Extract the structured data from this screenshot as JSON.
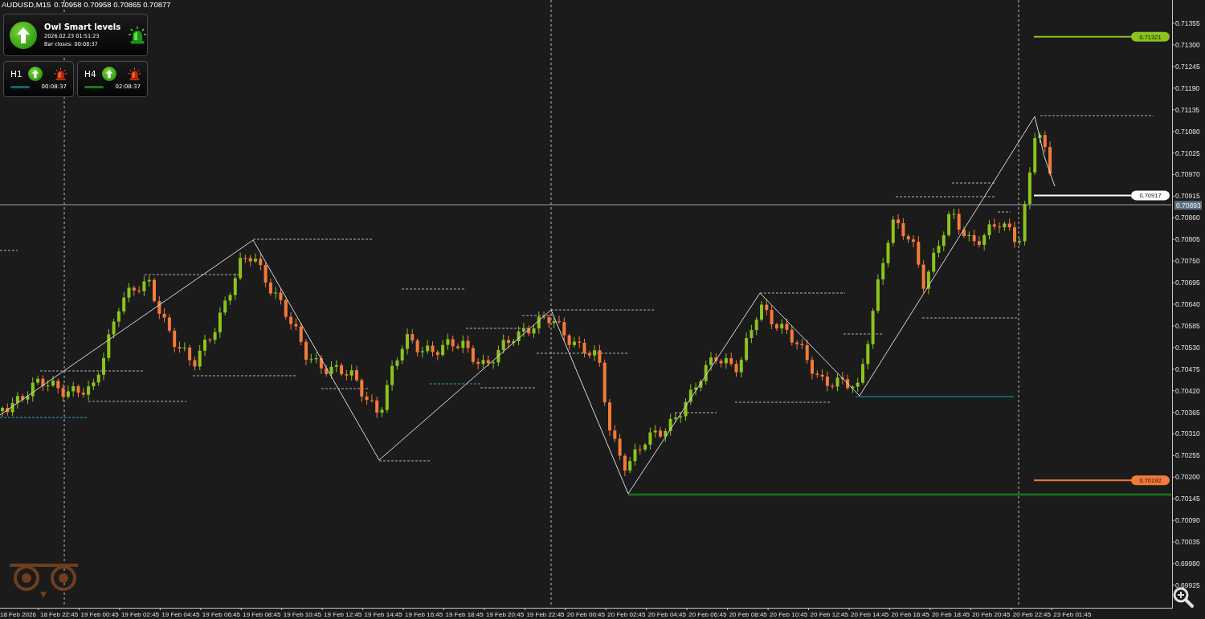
{
  "header": {
    "symbol": "AUDUSD,M15",
    "ohlc": [
      "0.70958",
      "0.70958",
      "0.70865",
      "0.70877"
    ]
  },
  "indicator_panel": {
    "title": "Owl Smart levels",
    "timestamp": "2026.02.23 01:51:23",
    "bar_closes": "Bar closes: 00:08:37"
  },
  "timeframes": [
    {
      "label": "H1",
      "timer": "00:08:37",
      "color": "#0e6674"
    },
    {
      "label": "H4",
      "timer": "02:08:37",
      "color": "#1a7a1a"
    }
  ],
  "price_axis": {
    "ticks": [
      "0.71355",
      "0.71300",
      "0.71245",
      "0.71190",
      "0.71135",
      "0.71080",
      "0.71025",
      "0.70970",
      "0.70915",
      "0.70860",
      "0.70805",
      "0.70750",
      "0.70695",
      "0.70640",
      "0.70585",
      "0.70530",
      "0.70475",
      "0.70420",
      "0.70365",
      "0.70310",
      "0.70255",
      "0.70200",
      "0.70145",
      "0.70090",
      "0.70035",
      "0.69980",
      "0.69925"
    ],
    "current_price": "0.70893"
  },
  "level_tags": [
    {
      "value": "0.71321",
      "color": "#8cc31e"
    },
    {
      "value": "0.70917",
      "color": "#ffffff"
    },
    {
      "value": "0.70192",
      "color": "#f47a3a"
    }
  ],
  "time_axis": {
    "labels": [
      "18 Feb 2026",
      "18 Feb 22:45",
      "19 Feb 00:45",
      "19 Feb 02:45",
      "19 Feb 04:45",
      "19 Feb 06:45",
      "19 Feb 08:45",
      "19 Feb 10:45",
      "19 Feb 12:45",
      "19 Feb 14:45",
      "19 Feb 16:45",
      "19 Feb 18:45",
      "19 Feb 20:45",
      "19 Feb 22:45",
      "20 Feb 00:45",
      "20 Feb 02:45",
      "20 Feb 04:45",
      "20 Feb 06:45",
      "20 Feb 08:45",
      "20 Feb 10:45",
      "20 Feb 12:45",
      "20 Feb 14:45",
      "20 Feb 16:45",
      "20 Feb 18:45",
      "20 Feb 20:45",
      "20 Feb 22:45",
      "23 Feb 01:45"
    ]
  }
}
